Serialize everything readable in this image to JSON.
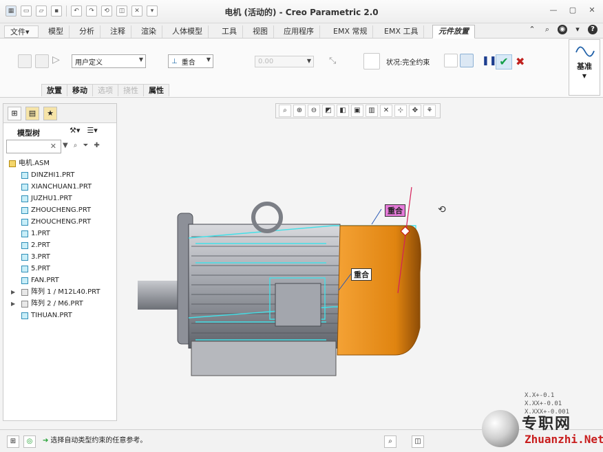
{
  "window": {
    "title": "电机 (活动的) - Creo Parametric 2.0"
  },
  "ribbon_tabs": [
    "文件▾",
    "模型",
    "分析",
    "注释",
    "渲染",
    "人体模型",
    "工具",
    "视图",
    "应用程序",
    "EMX 常规",
    "EMX 工具",
    "元件放置"
  ],
  "ribbon": {
    "user_defined": "用户定义",
    "constraint": "重合",
    "offset_value": "0.00",
    "status_label": "状况:完全约束",
    "datum_label": "基准"
  },
  "subtabs": [
    "放置",
    "移动",
    "选项",
    "挠性",
    "属性"
  ],
  "model_tree": {
    "label": "模型树",
    "items": [
      {
        "name": "电机.ASM",
        "type": "asm"
      },
      {
        "name": "DINZHI1.PRT",
        "type": "prt"
      },
      {
        "name": "XIANCHUAN1.PRT",
        "type": "prt"
      },
      {
        "name": "JUZHU1.PRT",
        "type": "prt"
      },
      {
        "name": "ZHOUCHENG.PRT",
        "type": "prt"
      },
      {
        "name": "ZHOUCHENG.PRT",
        "type": "prt"
      },
      {
        "name": "1.PRT",
        "type": "prt"
      },
      {
        "name": "2.PRT",
        "type": "prt"
      },
      {
        "name": "3.PRT",
        "type": "prt"
      },
      {
        "name": "5.PRT",
        "type": "prt"
      },
      {
        "name": "FAN.PRT",
        "type": "prt"
      },
      {
        "name": "阵列 1 / M12L40.PRT",
        "type": "pattern"
      },
      {
        "name": "阵列 2 / M6.PRT",
        "type": "pattern"
      },
      {
        "name": "TIHUAN.PRT",
        "type": "prt"
      }
    ]
  },
  "viewport": {
    "tag_top": "重合",
    "tag_mid": "重合",
    "tolerances": [
      "X.X+-0.1",
      "X.XX+-0.01",
      "X.XXX+-0.001"
    ]
  },
  "statusbar": {
    "message": "选择自动类型约束的任意参考。"
  },
  "watermark": {
    "cn": "专职网",
    "en": "Zhuanzhi.Net"
  },
  "colors": {
    "accent_tab": "#2a6db8",
    "highlight_cyan": "#43e0e8",
    "housing_orange": "#e68a10",
    "tag_pink": "#e47ad8"
  }
}
